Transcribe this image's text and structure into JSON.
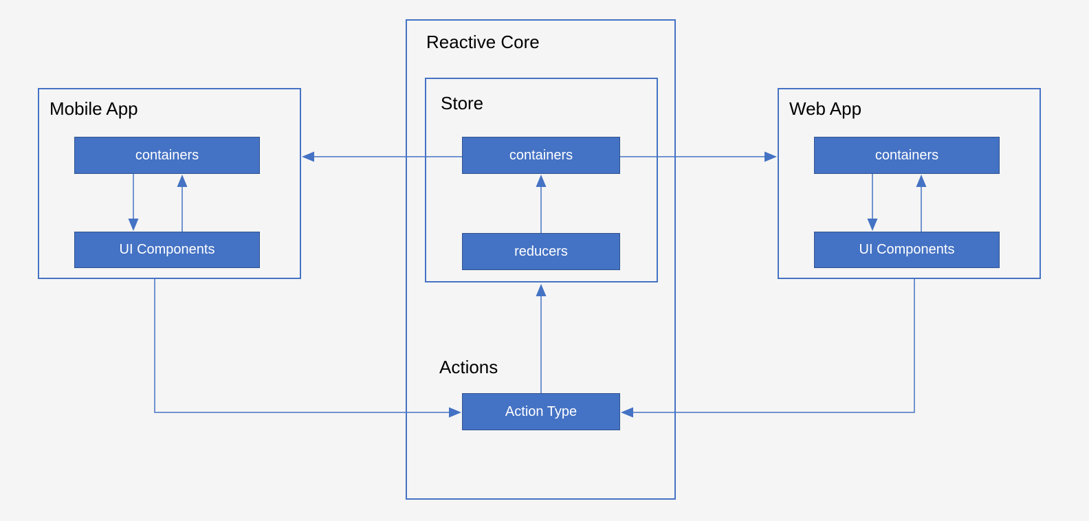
{
  "colors": {
    "accent": "#4472c4",
    "border": "#2f528f",
    "bg": "#f5f5f5",
    "text_light": "#ffffff",
    "text_dark": "#000000"
  },
  "mobile": {
    "title": "Mobile App",
    "containers": "containers",
    "ui": "UI Components"
  },
  "core": {
    "title": "Reactive Core",
    "store_title": "Store",
    "containers": "containers",
    "reducers": "reducers",
    "actions_title": "Actions",
    "action_type": "Action Type"
  },
  "web": {
    "title": "Web App",
    "containers": "containers",
    "ui": "UI Components"
  }
}
